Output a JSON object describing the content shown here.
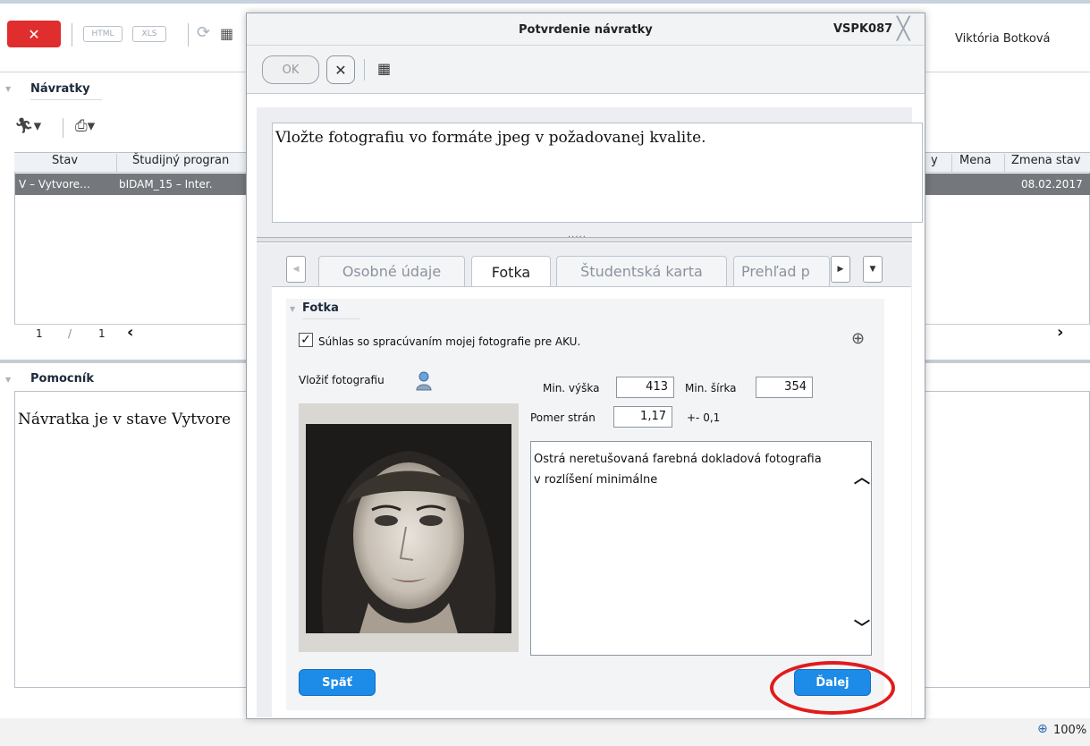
{
  "app": {
    "close_label": "✕",
    "html_label": "HTML",
    "xls_label": "XLS",
    "user_name": "Viktória Botková"
  },
  "navratky": {
    "section_title": "Návratky",
    "columns": [
      "Stav",
      "Študijný progran",
      "y",
      "Mena",
      "Zmena stav"
    ],
    "row": {
      "stav": "V – Vytvore…",
      "program": "bIDAM_15 – Inter.",
      "zmena": "08.02.2017"
    },
    "pager": {
      "current": "1",
      "sep": "/",
      "total": "1"
    }
  },
  "helper": {
    "section_title": "Pomocník",
    "text": "Návratka je v stave Vytvore"
  },
  "status": {
    "zoom": "100%"
  },
  "dialog": {
    "title": "Potvrdenie návratky",
    "code": "VSPK087",
    "ok_label": "OK",
    "cancel_label": "✕",
    "info_text": "Vložte fotografiu vo formáte jpeg v požadovanej kvalite.",
    "splitter_dots": "·····",
    "tabs": [
      "Osobné údaje",
      "Fotka",
      "Študentská karta",
      "Prehľad p"
    ],
    "fotka": {
      "section_title": "Fotka",
      "checkbox_label": "Súhlas so spracúvaním mojej fotografie pre AKU.",
      "checkbox_checked": true,
      "insert_label": "Vložiť fotografiu",
      "min_height_label": "Min. výška",
      "min_height_value": "413",
      "min_width_label": "Min. šírka",
      "min_width_value": "354",
      "ratio_label": "Pomer strán",
      "ratio_value": "1,17",
      "ratio_tolerance": "+- 0,1",
      "description": "Ostrá neretušovaná farebná dokladová fotografia v rozlíšení minimálne"
    },
    "back_label": "Späť",
    "next_label": "Ďalej"
  }
}
